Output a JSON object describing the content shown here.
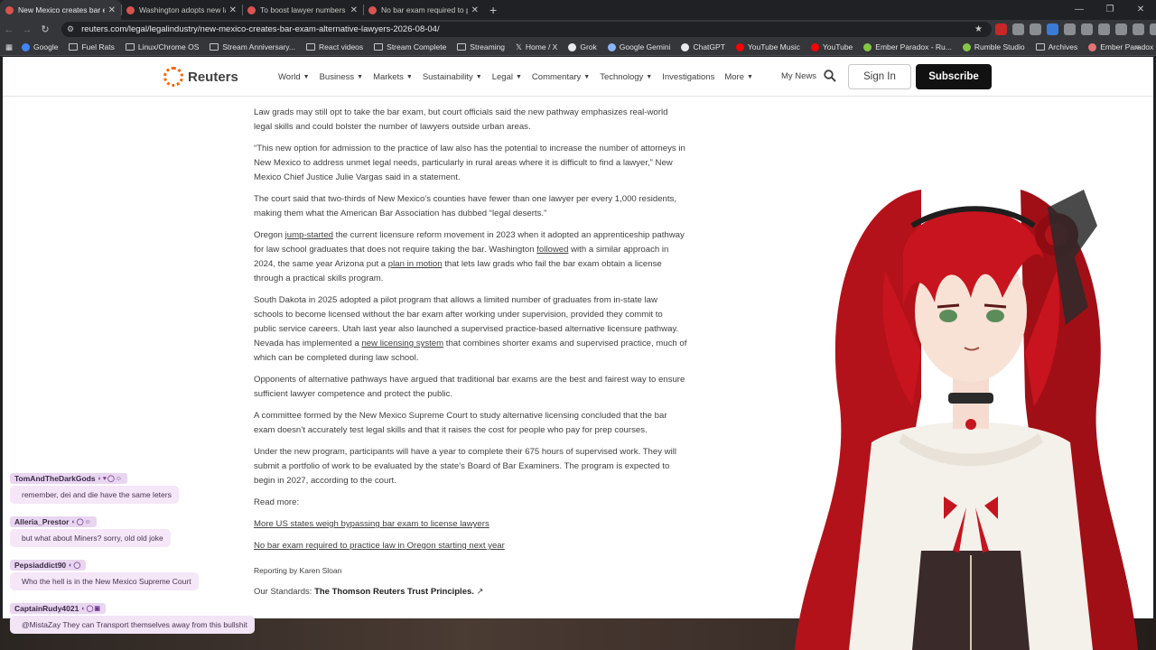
{
  "browser": {
    "tabs": [
      {
        "title": "New Mexico creates bar exam",
        "active": true
      },
      {
        "title": "Washington adopts new lawye",
        "active": false
      },
      {
        "title": "To boost lawyer numbers in 'le",
        "active": false
      },
      {
        "title": "No bar exam required to practi",
        "active": false
      }
    ],
    "url": "reuters.com/legal/legalindustry/new-mexico-creates-bar-exam-alternative-lawyers-2026-08-04/",
    "bookmarks": [
      {
        "label": "Google",
        "icon": "google-icon",
        "color": "#4285f4"
      },
      {
        "label": "Fuel Rats",
        "icon": "folder-icon",
        "color": ""
      },
      {
        "label": "Linux/Chrome OS",
        "icon": "folder-icon",
        "color": ""
      },
      {
        "label": "Stream Anniversary...",
        "icon": "folder-icon",
        "color": ""
      },
      {
        "label": "React videos",
        "icon": "folder-icon",
        "color": ""
      },
      {
        "label": "Stream Complete",
        "icon": "folder-icon",
        "color": ""
      },
      {
        "label": "Streaming",
        "icon": "folder-icon",
        "color": ""
      },
      {
        "label": "Home / X",
        "icon": "x-icon",
        "color": "#e8eaed"
      },
      {
        "label": "Grok",
        "icon": "grok-icon",
        "color": "#e8eaed"
      },
      {
        "label": "Google Gemini",
        "icon": "gemini-icon",
        "color": "#8ab4f8"
      },
      {
        "label": "ChatGPT",
        "icon": "chatgpt-icon",
        "color": "#e8eaed"
      },
      {
        "label": "YouTube Music",
        "icon": "youtube-music-icon",
        "color": "#ff0000"
      },
      {
        "label": "YouTube",
        "icon": "youtube-icon",
        "color": "#ff0000"
      },
      {
        "label": "Ember Paradox - Ru...",
        "icon": "rumble-icon",
        "color": "#85c742"
      },
      {
        "label": "Rumble Studio",
        "icon": "rumble-icon",
        "color": "#85c742"
      },
      {
        "label": "Archives",
        "icon": "folder-icon",
        "color": ""
      },
      {
        "label": "Ember Paradox",
        "icon": "avatar-icon",
        "color": "#e57373"
      }
    ]
  },
  "site": {
    "logo": "Reuters",
    "menu": [
      {
        "label": "World",
        "dropdown": true
      },
      {
        "label": "Business",
        "dropdown": true
      },
      {
        "label": "Markets",
        "dropdown": true
      },
      {
        "label": "Sustainability",
        "dropdown": true
      },
      {
        "label": "Legal",
        "dropdown": true
      },
      {
        "label": "Commentary",
        "dropdown": true
      },
      {
        "label": "Technology",
        "dropdown": true
      },
      {
        "label": "Investigations",
        "dropdown": false
      },
      {
        "label": "More",
        "dropdown": true
      }
    ],
    "my_news": "My News",
    "sign_in": "Sign In",
    "subscribe": "Subscribe",
    "brand_color": "#fa6400"
  },
  "article": {
    "p1": "Law grads may still opt to take the bar exam, but court officials said the new pathway emphasizes real-world legal skills and could bolster the number of lawyers outside urban areas.",
    "p2": "“This new option for admission to the practice of law also has the potential to increase the number of attorneys in New Mexico to address unmet legal needs, particularly in rural areas where it is difficult to find a lawyer,” New Mexico Chief Justice Julie Vargas said in a statement.",
    "p3": "The court said that two-thirds of New Mexico’s counties have fewer than one lawyer per every 1,000 residents, making them what the American Bar Association has dubbed “legal deserts.”",
    "p4": {
      "a": "Oregon ",
      "link1": "jump-started",
      "b": " the current licensure reform movement in 2023 when it adopted an apprenticeship pathway for law school graduates that does not require taking the bar. Washington ",
      "link2": "followed",
      "c": " with a similar approach in 2024, the same year Arizona put a ",
      "link3": "plan in motion",
      "d": " that lets law grads who fail the bar exam obtain a license through a practical skills program."
    },
    "p5": {
      "a": "South Dakota in 2025 adopted a pilot program that allows a limited number of graduates from in-state law schools to become licensed without the bar exam after working under supervision, provided they commit to public service careers. Utah last year also launched a supervised practice-based alternative licensure pathway. Nevada has implemented a ",
      "link": "new licensing system",
      "b": " that combines shorter exams and supervised practice, much of which can be completed during law school."
    },
    "p6": "Opponents of alternative pathways have argued that traditional bar exams are the best and fairest way to ensure sufficient lawyer competence and protect the public.",
    "p7": "A committee formed by the New Mexico Supreme Court to study alternative licensing concluded that the bar exam doesn’t accurately test legal skills and that it raises the cost for people who pay for prep courses.",
    "p8": "Under the new program, participants will have a year to complete their 675 hours of supervised work. They will submit a portfolio of work to be evaluated by the state’s Board of Bar Examiners. The program is expected to begin in 2027, according to the court.",
    "read_more": "Read more:",
    "read_more_links": [
      "More US states weigh bypassing bar exam to license lawyers",
      "No bar exam required to practice law in Oregon starting next year"
    ],
    "byline": "Reporting by Karen Sloan",
    "standards_prefix": "Our Standards: ",
    "standards_link": "The Thomson Reuters Trust Principles."
  },
  "chat": [
    {
      "user": "TomAndTheDarkGods",
      "message": "remember, dei and die have the same leters"
    },
    {
      "user": "Alleria_Prestor",
      "message": "but what about Miners? sorry, old old joke"
    },
    {
      "user": "Pepsiaddict90",
      "message": "Who the hell is in the New Mexico Supreme Court"
    },
    {
      "user": "CaptainRudy4021",
      "message": "@MistaZay They can Transport themselves away from this bullshit"
    }
  ]
}
